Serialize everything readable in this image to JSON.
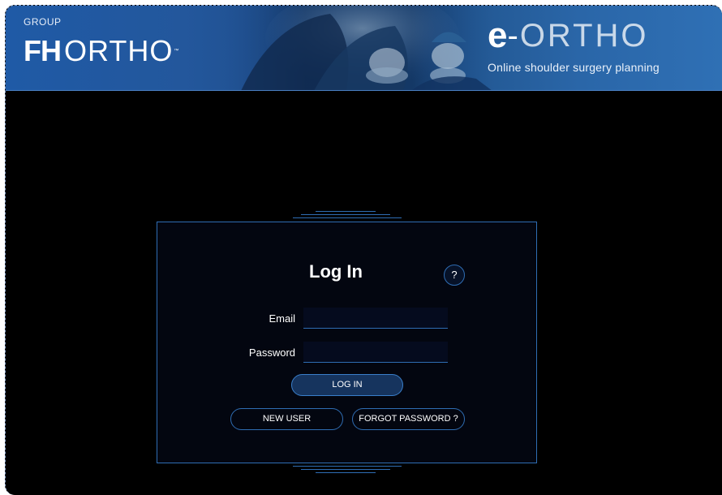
{
  "header": {
    "brand_group": "GROUP",
    "brand_fh": "FH",
    "brand_ortho": "ORTHO",
    "brand_tm": "™",
    "product_e": "e",
    "product_dash": "-",
    "product_ortho": "ORTHO",
    "tagline": "Online shoulder surgery planning"
  },
  "login": {
    "title": "Log In",
    "help_label": "?",
    "email_label": "Email",
    "email_value": "",
    "password_label": "Password",
    "password_value": "",
    "login_button": "LOG IN",
    "new_user_button": "NEW USER",
    "forgot_password_button": "FORGOT PASSWORD ?"
  },
  "colors": {
    "header_blue": "#1f5aa6",
    "accent_blue": "#2f6db3",
    "primary_button": "#16345e",
    "background": "#000000"
  }
}
